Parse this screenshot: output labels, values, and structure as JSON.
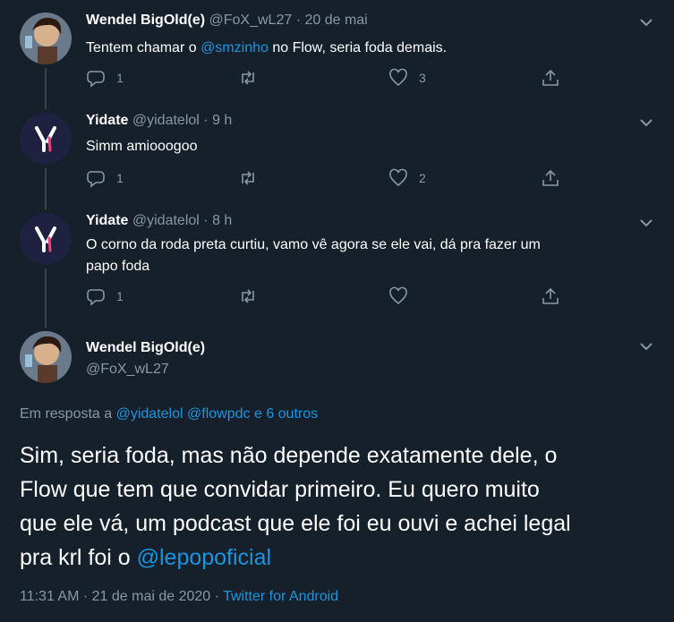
{
  "replies": [
    {
      "name": "Wendel BigOld(e)",
      "handle": "@FoX_wL27",
      "sep": "·",
      "time": "20 de mai",
      "text_before": "Tentem chamar o ",
      "mention": "@smzinho",
      "text_after": " no Flow, seria foda demais.",
      "reply_count": "1",
      "retweet_count": "",
      "like_count": "3"
    },
    {
      "name": "Yidate",
      "handle": "@yidatelol",
      "sep": "·",
      "time": "9 h",
      "text": "Simm amiooogoo",
      "reply_count": "1",
      "retweet_count": "",
      "like_count": "2",
      "avatar_letter": "Y"
    },
    {
      "name": "Yidate",
      "handle": "@yidatelol",
      "sep": "·",
      "time": "8 h",
      "text_line1": "O corno da roda preta curtiu, vamo vê agora se ele vai, dá pra fazer um",
      "text_line2": "papo foda",
      "reply_count": "1",
      "retweet_count": "",
      "like_count": "",
      "avatar_letter": "Y"
    }
  ],
  "focus": {
    "name": "Wendel BigOld(e)",
    "handle": "@FoX_wL27",
    "reply_prefix": "Em resposta a ",
    "reply_mention1": "@yidatelol",
    "reply_mention2": "@flowpdc",
    "reply_others": "e 6 outros",
    "line1": "Sim, seria foda, mas não depende exatamente dele, o",
    "line2": "Flow que tem que convidar primeiro. Eu quero muito",
    "line3": "que ele vá, um podcast que ele foi eu ouvi e achei legal",
    "line4_before": "pra krl foi o ",
    "line4_mention": "@lepopoficial",
    "timestamp": "11:31 AM · 21 de mai de 2020 · ",
    "client": "Twitter for Android"
  },
  "icons": {
    "reply": "reply-icon",
    "retweet": "retweet-icon",
    "like": "heart-icon",
    "share": "share-icon",
    "caret": "chevron-down-icon"
  },
  "colors": {
    "background": "#15202b",
    "muted": "#8899a6",
    "link": "#1b95e0",
    "divider": "#38444d"
  }
}
